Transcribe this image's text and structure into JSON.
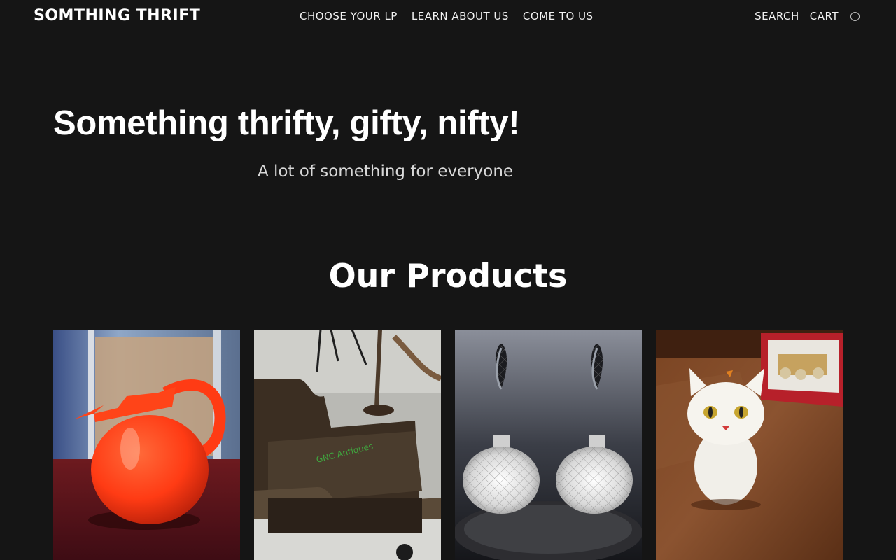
{
  "header": {
    "logo": "SOMTHING THRIFT",
    "nav": [
      {
        "label": "CHOOSE YOUR LP"
      },
      {
        "label": "LEARN ABOUT US"
      },
      {
        "label": "COME TO US"
      }
    ],
    "actions": {
      "search": "SEARCH",
      "cart": "CART",
      "account_icon": "circle-icon"
    }
  },
  "hero": {
    "title": "Something thrifty, gifty, nifty!",
    "subtitle": "A lot of something for everyone"
  },
  "products_section": {
    "title": "Our Products",
    "items": [
      {
        "image": "red-pitcher",
        "watermark": ""
      },
      {
        "image": "vintage-tray-table",
        "watermark": "GNC Antiques"
      },
      {
        "image": "crystal-perfume-bottles",
        "watermark": ""
      },
      {
        "image": "ceramic-cat-figurine",
        "watermark": ""
      }
    ]
  },
  "colors": {
    "background": "#151515",
    "text": "#ffffff",
    "subtitle": "#d8d8d8"
  }
}
